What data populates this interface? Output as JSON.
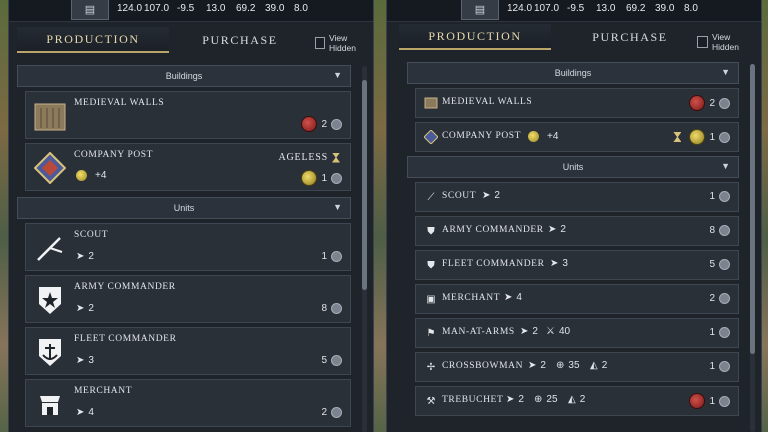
{
  "yields": [
    "124.0",
    "107.0",
    "-9.5",
    "13.0",
    "69.2",
    "39.0",
    "8.0"
  ],
  "tabs": {
    "production": "PRODUCTION",
    "purchase": "PURCHASE"
  },
  "view_hidden_label": "View Hidden",
  "sections": {
    "buildings": "Buildings",
    "units": "Units"
  },
  "left_items": {
    "medieval_walls": {
      "name": "MEDIEVAL WALLS",
      "turns": "2"
    },
    "company_post": {
      "name": "COMPANY POST",
      "bonus": "+4",
      "tag": "AGELESS",
      "turns": "1"
    },
    "scout": {
      "name": "SCOUT",
      "move": "2",
      "turns": "1"
    },
    "army_commander": {
      "name": "ARMY COMMANDER",
      "move": "2",
      "turns": "8"
    },
    "fleet_commander": {
      "name": "FLEET COMMANDER",
      "move": "3",
      "turns": "5"
    },
    "merchant": {
      "name": "MERCHANT",
      "move": "4",
      "turns": "2"
    }
  },
  "right_items": {
    "medieval_walls": {
      "name": "MEDIEVAL WALLS",
      "turns": "2"
    },
    "company_post": {
      "name": "COMPANY POST",
      "bonus": "+4",
      "turns": "1"
    },
    "scout": {
      "name": "SCOUT",
      "move": "2",
      "turns": "1"
    },
    "army_commander": {
      "name": "ARMY COMMANDER",
      "move": "2",
      "turns": "8"
    },
    "fleet_commander": {
      "name": "FLEET COMMANDER",
      "move": "3",
      "turns": "5"
    },
    "merchant": {
      "name": "MERCHANT",
      "move": "4",
      "turns": "2"
    },
    "man_at_arms": {
      "name": "MAN-AT-ARMS",
      "move": "2",
      "strength": "40",
      "turns": "1"
    },
    "crossbowman": {
      "name": "CROSSBOWMAN",
      "move": "2",
      "ranged": "35",
      "range": "2",
      "turns": "1"
    },
    "trebuchet": {
      "name": "TREBUCHET",
      "move": "2",
      "ranged": "25",
      "range": "2",
      "turns": "1"
    }
  },
  "icons": {
    "city": "scroll-icon",
    "arrow": "movement-arrow-icon",
    "clock": "turns-clock-icon",
    "red_coin": "red-medallion-icon",
    "gold_coin": "gold-medallion-icon",
    "hourglass": "hourglass-icon",
    "chevron": "collapse-chevron-icon"
  }
}
